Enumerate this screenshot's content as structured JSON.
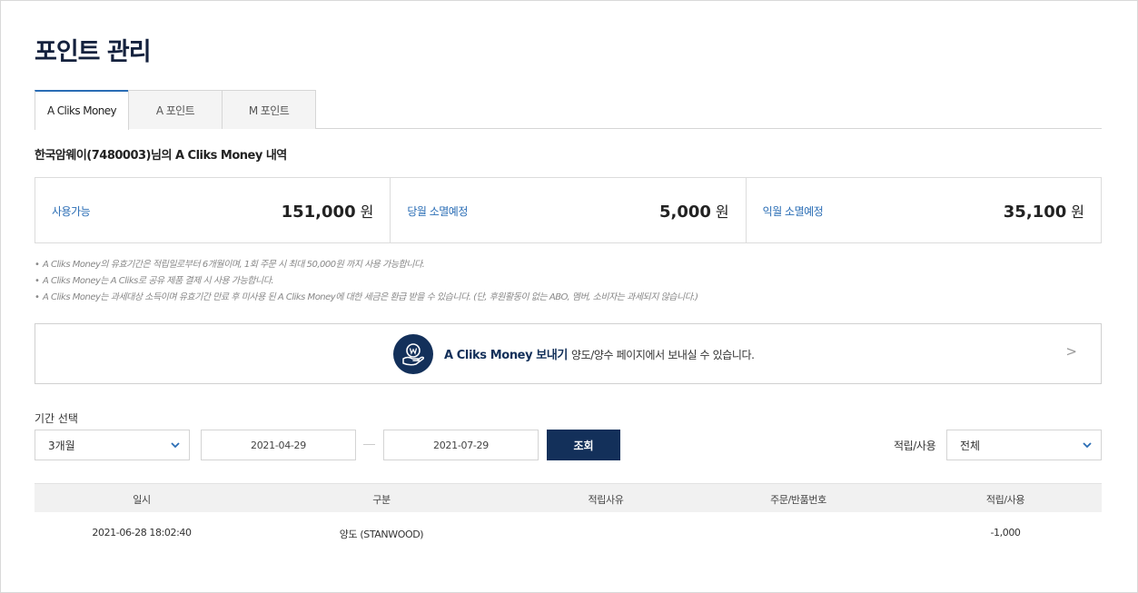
{
  "page": {
    "title": "포인트 관리"
  },
  "tabs": [
    {
      "label": "A Cliks Money",
      "active": true
    },
    {
      "label": "A 포인트",
      "active": false
    },
    {
      "label": "M 포인트",
      "active": false
    }
  ],
  "account": {
    "heading": "한국암웨이(7480003)님의 A Cliks Money 내역"
  },
  "summary": {
    "available": {
      "label": "사용가능",
      "value": "151,000",
      "unit": "원"
    },
    "this_month_expiring": {
      "label": "당월 소멸예정",
      "value": "5,000",
      "unit": "원"
    },
    "next_month_expiring": {
      "label": "익월 소멸예정",
      "value": "35,100",
      "unit": "원"
    }
  },
  "notes": [
    "A Cliks Money의 유효기간은 적립일로부터 6개월이며, 1회 주문 시 최대 50,000원 까지 사용 가능합니다.",
    "A Cliks Money는 A Cliks로 공유 제품 결제 시 사용 가능합니다.",
    "A Cliks Money는 과세대상 소득이며 유효기간 만료 후 미사용 된 A Cliks Money에 대한 세금은 환급 받을 수 있습니다. (단, 후원활동이 없는 ABO, 멤버, 소비자는 과세되지 않습니다.)"
  ],
  "send_banner": {
    "title": "A Cliks Money 보내기",
    "text": "양도/양수 페이지에서 보내실 수 있습니다.",
    "arrow": ">",
    "icon": "money-hand-icon"
  },
  "filter": {
    "period_label": "기간 선택",
    "period_value": "3개월",
    "start_date": "2021-04-29",
    "end_date": "2021-07-29",
    "search_label": "조회",
    "type_label": "적립/사용",
    "type_value": "전체"
  },
  "table": {
    "headers": [
      "일시",
      "구분",
      "적립사유",
      "주문/반품번호",
      "적립/사용"
    ],
    "rows": [
      [
        "2021-06-28 18:02:40",
        "양도 (STANWOOD)",
        "",
        "",
        "-1,000"
      ]
    ]
  },
  "colors": {
    "accent": "#2a6db5",
    "navy": "#13305a"
  }
}
